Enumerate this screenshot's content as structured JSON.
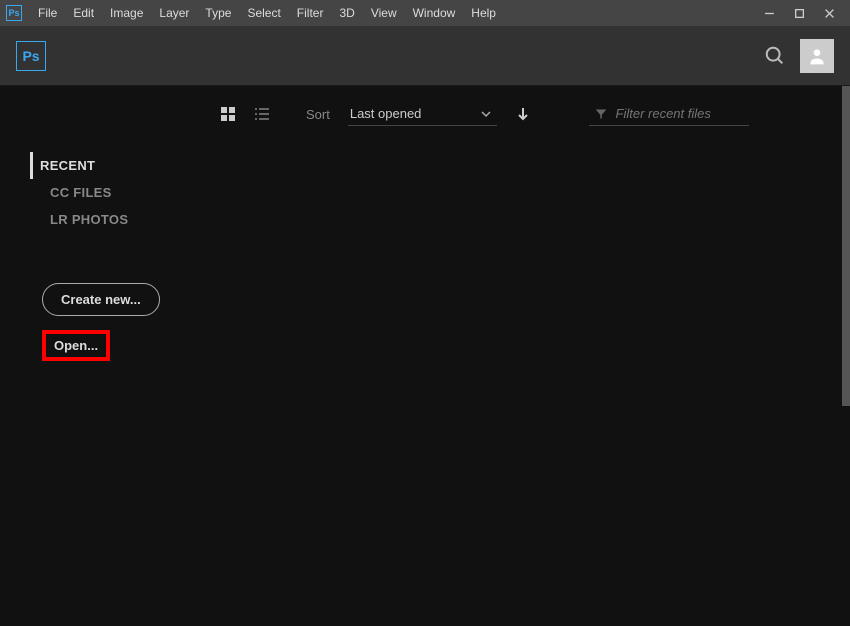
{
  "menubar": {
    "items": [
      "File",
      "Edit",
      "Image",
      "Layer",
      "Type",
      "Select",
      "Filter",
      "3D",
      "View",
      "Window",
      "Help"
    ]
  },
  "app": {
    "abbr": "Ps"
  },
  "sidebar": {
    "items": [
      {
        "label": "RECENT",
        "active": true
      },
      {
        "label": "CC FILES",
        "active": false
      },
      {
        "label": "LR PHOTOS",
        "active": false
      }
    ],
    "create_label": "Create new...",
    "open_label": "Open..."
  },
  "content": {
    "sort_label": "Sort",
    "sort_value": "Last opened",
    "filter_placeholder": "Filter recent files"
  }
}
